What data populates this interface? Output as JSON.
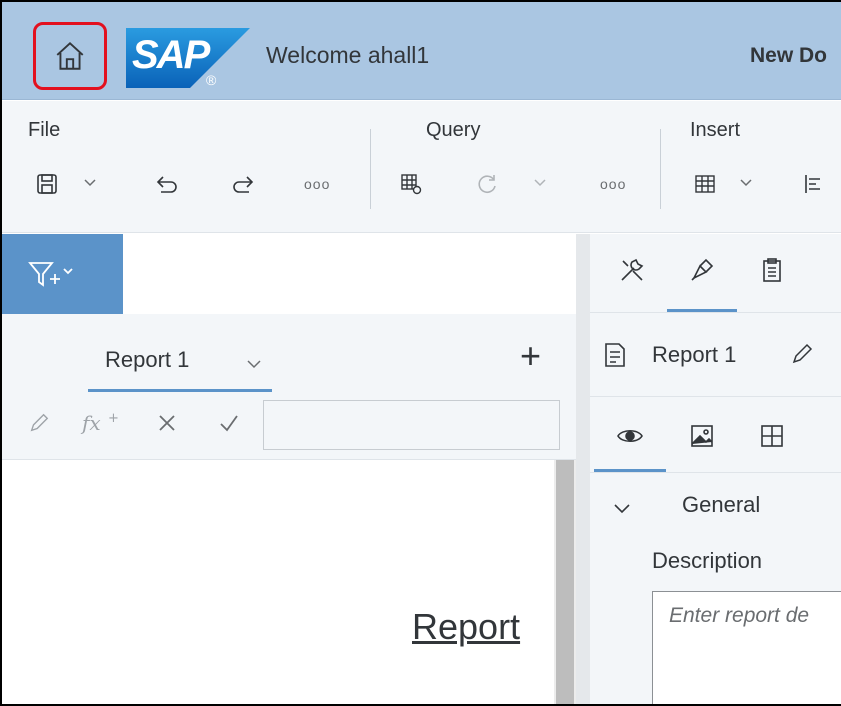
{
  "shell": {
    "welcome": "Welcome ahall1",
    "document_title": "New Do",
    "logo_text": "SAP",
    "logo_mark": "®"
  },
  "toolbar": {
    "groups": [
      {
        "label": "File"
      },
      {
        "label": "Query"
      },
      {
        "label": "Insert"
      }
    ],
    "more_label": "ooo"
  },
  "left_panel": {
    "report_tab_label": "Report 1",
    "add_label": "+",
    "canvas_title": "Report"
  },
  "right_panel": {
    "report_name": "Report 1",
    "section_general": "General",
    "description_label": "Description",
    "description_placeholder": "Enter report de"
  },
  "colors": {
    "shell_bg": "#aac6e2",
    "accent": "#5b93c9",
    "highlight_border": "#e3101e",
    "toolbar_bg": "#f3f6f9"
  },
  "icons": [
    "home-icon",
    "save-icon",
    "undo-icon",
    "redo-icon",
    "query-settings-icon",
    "refresh-icon",
    "table-icon",
    "align-icon",
    "filter-icon",
    "tools-icon",
    "format-icon",
    "clipboard-icon",
    "document-icon",
    "pencil-icon",
    "eye-icon",
    "image-icon",
    "grid-icon",
    "function-icon",
    "cancel-icon",
    "check-icon",
    "chevron-down-icon"
  ]
}
